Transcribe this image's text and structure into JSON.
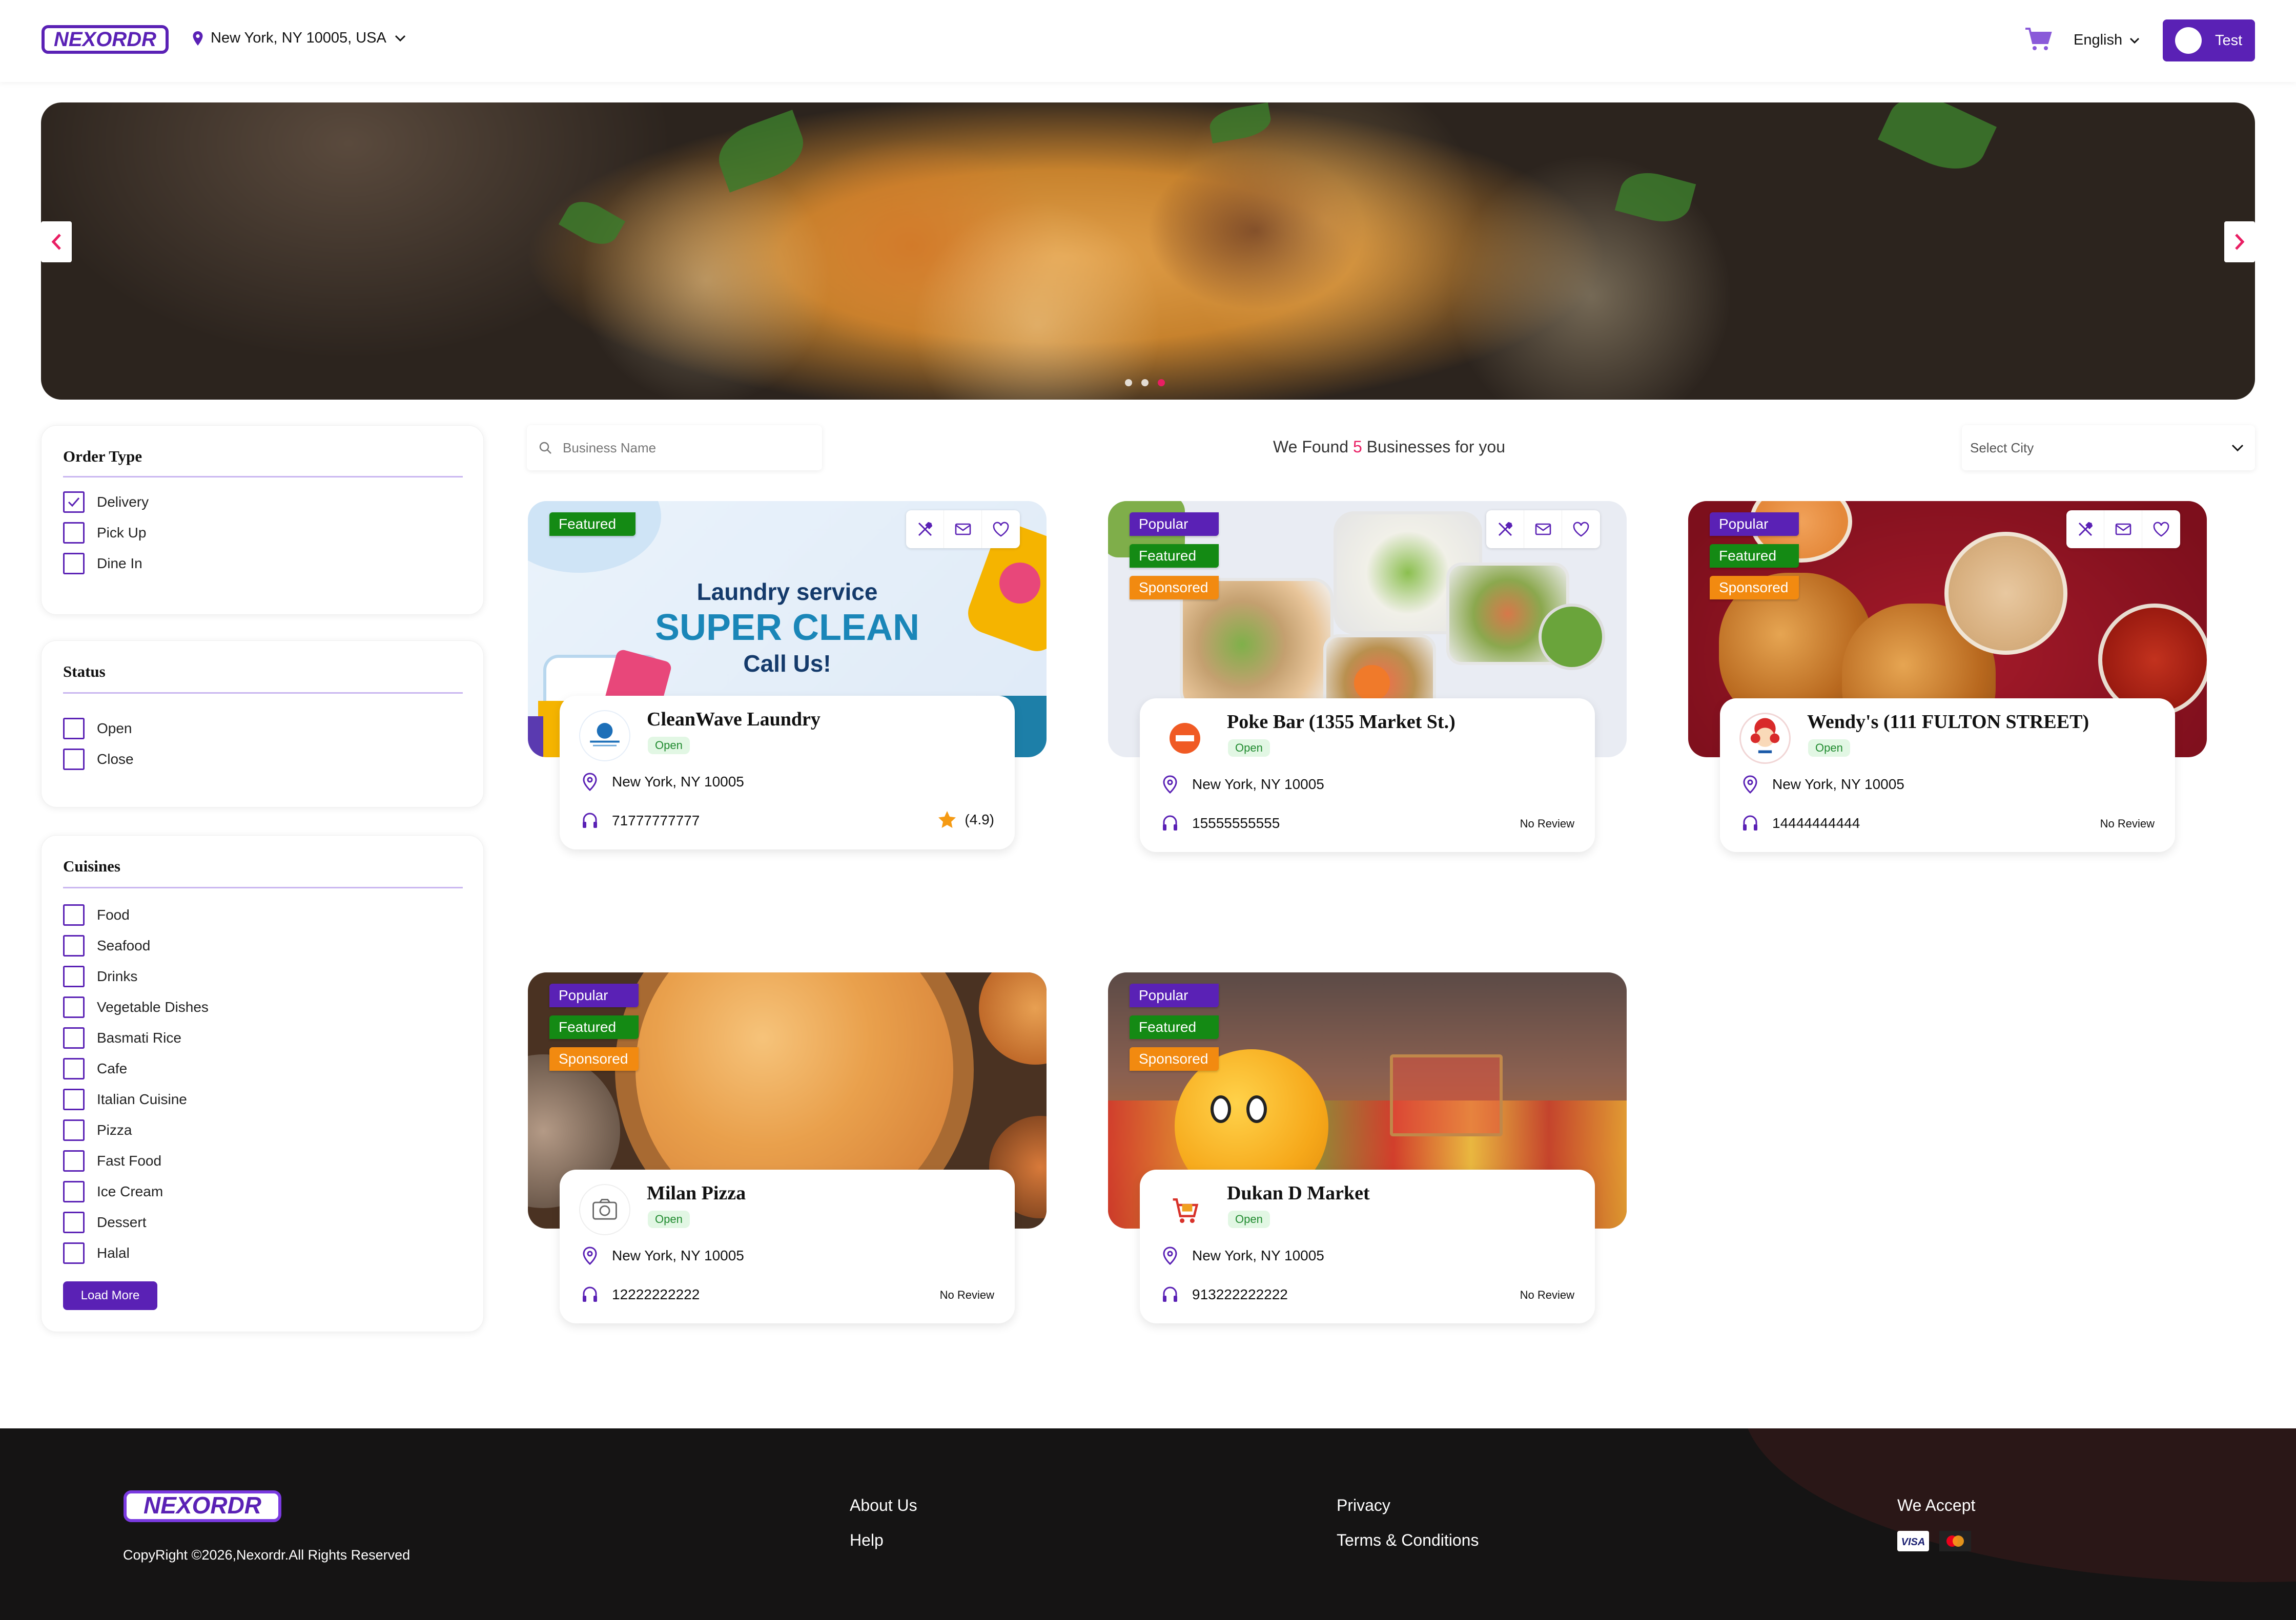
{
  "header": {
    "logo_text": "NEXORDR",
    "location": "New York, NY 10005, USA",
    "language": "English",
    "user": "Test"
  },
  "banner": {
    "slides": 3,
    "active_slide": 3
  },
  "filters": {
    "order_type": {
      "title": "Order Type",
      "options": [
        {
          "label": "Delivery",
          "checked": true
        },
        {
          "label": "Pick Up",
          "checked": false
        },
        {
          "label": "Dine In",
          "checked": false
        }
      ]
    },
    "status": {
      "title": "Status",
      "options": [
        {
          "label": "Open",
          "checked": false
        },
        {
          "label": "Close",
          "checked": false
        }
      ]
    },
    "cuisines": {
      "title": "Cuisines",
      "options": [
        {
          "label": "Food"
        },
        {
          "label": "Seafood"
        },
        {
          "label": "Drinks"
        },
        {
          "label": "Vegetable Dishes"
        },
        {
          "label": "Basmati Rice"
        },
        {
          "label": "Cafe"
        },
        {
          "label": "Italian Cuisine"
        },
        {
          "label": "Pizza"
        },
        {
          "label": "Fast Food"
        },
        {
          "label": "Ice Cream"
        },
        {
          "label": "Dessert"
        },
        {
          "label": "Halal"
        }
      ],
      "load_more": "Load More"
    }
  },
  "search": {
    "placeholder": "Business Name"
  },
  "results": {
    "prefix": "We Found",
    "count": "5",
    "suffix": "Businesses for you"
  },
  "city_select": {
    "placeholder": "Select City"
  },
  "businesses": [
    {
      "name": "CleanWave Laundry",
      "status": "Open",
      "address": "New York, NY 10005",
      "phone": "71777777777",
      "rating": "(4.9)",
      "badges": [
        "Featured"
      ],
      "banner_text": {
        "line1": "Laundry service",
        "line2": "SUPER CLEAN",
        "line3": "Call Us!"
      }
    },
    {
      "name": "Poke Bar (1355 Market St.)",
      "status": "Open",
      "address": "New York, NY 10005",
      "phone": "15555555555",
      "review": "No Review",
      "badges": [
        "Popular",
        "Featured",
        "Sponsored"
      ]
    },
    {
      "name": "Wendy's (111 FULTON STREET)",
      "status": "Open",
      "address": "New York, NY 10005",
      "phone": "14444444444",
      "review": "No Review",
      "badges": [
        "Popular",
        "Featured",
        "Sponsored"
      ]
    },
    {
      "name": "Milan Pizza",
      "status": "Open",
      "address": "New York, NY 10005",
      "phone": "12222222222",
      "review": "No Review",
      "badges": [
        "Popular",
        "Featured",
        "Sponsored"
      ]
    },
    {
      "name": "Dukan D Market",
      "status": "Open",
      "address": "New York, NY 10005",
      "phone": "913222222222",
      "review": "No Review",
      "badges": [
        "Popular",
        "Featured",
        "Sponsored"
      ]
    }
  ],
  "footer": {
    "copyright": "CopyRight ©2026,Nexordr.All Rights Reserved",
    "links": [
      "About Us",
      "Help",
      "Privacy",
      "Terms & Conditions"
    ],
    "we_accept": "We Accept",
    "payment_icons": [
      "visa-icon",
      "mastercard-icon"
    ]
  },
  "colors": {
    "brand": "#5a21b5",
    "accent": "#e91e63",
    "featured": "#148a14",
    "sponsored": "#f28a10",
    "open": "#1f8a2e"
  }
}
